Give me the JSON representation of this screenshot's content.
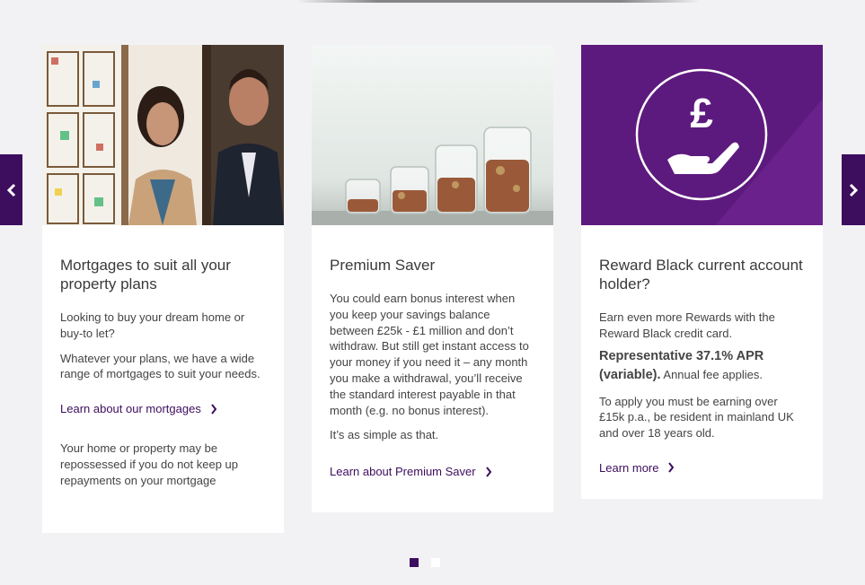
{
  "carousel": {
    "prev_icon": "chevron-left-icon",
    "next_icon": "chevron-right-icon",
    "cards": [
      {
        "title": "Mortgages to suit all your property plans",
        "paragraphs": [
          "Looking to buy your dream home or buy-to let?",
          "Whatever your plans, we have a wide range of mortgages to suit your needs."
        ],
        "link": "Learn about our mortgages",
        "disclaimer": "Your home or property may be repossessed if you do not keep up repayments on your mortgage"
      },
      {
        "title": "Premium Saver",
        "paragraphs": [
          "You could earn bonus interest when you keep your savings balance between £25k - £1 million and don’t withdraw. But still get instant access to your money if you need it – any month you make a withdrawal, you’ll receive the standard interest payable in that month (e.g. no bonus interest).",
          "It’s as simple as that."
        ],
        "link": "Learn about Premium Saver"
      },
      {
        "title": "Reward Black current account holder?",
        "paragraphs": [
          "Earn even more Rewards with the Reward Black credit card."
        ],
        "rep_bold": "Representative 37.1% APR (variable).",
        "rep_rest": " Annual fee applies.",
        "eligibility": "To apply you must be earning over £15k p.a., be resident in mainland UK and over 18 years old.",
        "link": "Learn more",
        "icon_symbol": "£"
      }
    ],
    "dots_count": 2,
    "active_dot": 0
  },
  "colors": {
    "brand_purple": "#3d0d5e",
    "background": "#f2f2f4"
  }
}
